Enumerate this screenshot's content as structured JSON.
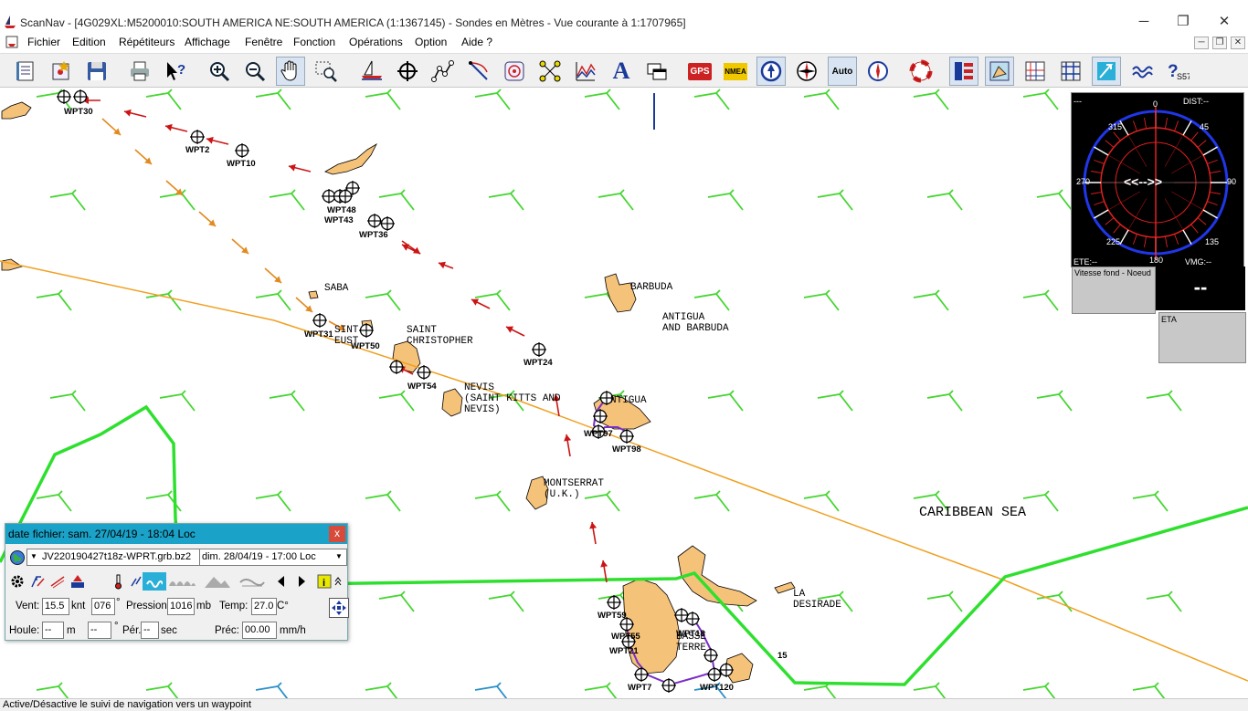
{
  "window": {
    "title": "ScanNav - [4G029XL:M5200010:SOUTH AMERICA NE:SOUTH AMERICA (1:1367145) - Sondes en  Mètres  - Vue courante à 1:1707965]"
  },
  "menu": {
    "items": [
      "Fichier",
      "Edition",
      "Répétiteurs",
      "Affichage",
      "Fenêtre",
      "Fonction",
      "Opérations",
      "Option",
      "Aide ?"
    ]
  },
  "toolbar": {
    "auto_label": "Auto",
    "gps_label": "GPS",
    "nmea_label": "NMEA",
    "text_label": "A"
  },
  "map": {
    "place_labels": [
      {
        "id": "saba",
        "text": "SABA"
      },
      {
        "id": "barbuda",
        "text": "BARBUDA"
      },
      {
        "id": "antigua-barbuda",
        "text": "ANTIGUA\nAND BARBUDA"
      },
      {
        "id": "saint-christopher",
        "text": "SAINT\nCHRISTOPHER"
      },
      {
        "id": "saint-eustatius",
        "text": "SINT\nEUST"
      },
      {
        "id": "nevis",
        "text": "NEVIS\n(SAINT KITTS AND\nNEVIS)"
      },
      {
        "id": "antigua",
        "text": "NTIGUA"
      },
      {
        "id": "montserrat",
        "text": "MONTSERRAT\n(U.K.)"
      },
      {
        "id": "caribbean-sea",
        "text": "CARIBBEAN SEA"
      },
      {
        "id": "la-desirade",
        "text": "LA\nDESIRADE"
      },
      {
        "id": "basse-terre",
        "text": "BASSE\nTERRE"
      },
      {
        "id": "depth-15",
        "text": "15"
      }
    ],
    "waypoints": [
      {
        "id": "wpt30",
        "label": "WPT30"
      },
      {
        "id": "wpt2",
        "label": "WPT2"
      },
      {
        "id": "wpt10",
        "label": "WPT10"
      },
      {
        "id": "wpt48",
        "label": "WPT48"
      },
      {
        "id": "wpt43",
        "label": "WPT43"
      },
      {
        "id": "wpt36",
        "label": "WPT36"
      },
      {
        "id": "wpt31",
        "label": "WPT31"
      },
      {
        "id": "wpt50",
        "label": "WPT50"
      },
      {
        "id": "wpt54",
        "label": "WPT54"
      },
      {
        "id": "wpt24",
        "label": "WPT24"
      },
      {
        "id": "wpt97",
        "label": "WPT97"
      },
      {
        "id": "wpt98",
        "label": "WPT98"
      },
      {
        "id": "wpt59",
        "label": "WPT59"
      },
      {
        "id": "wpt55",
        "label": "WPT55"
      },
      {
        "id": "wpt21",
        "label": "WPT21"
      },
      {
        "id": "wpt7",
        "label": "WPT7"
      },
      {
        "id": "wpt120",
        "label": "WPT120"
      },
      {
        "id": "wpt18",
        "label": "WPT18"
      }
    ]
  },
  "compass": {
    "top_label": "0",
    "dist_label": "DIST:--",
    "ete_label": "ETE:--",
    "vmg_label": "VMG:--",
    "bottom_label": "180",
    "center_text": "<<-->>",
    "top_left": "---",
    "bearings": [
      "315",
      "45",
      "270",
      "90",
      "225",
      "135"
    ]
  },
  "speed": {
    "label": "Vitesse fond - Noeud",
    "value": "--"
  },
  "eta": {
    "label": "ETA"
  },
  "grib": {
    "title": "date fichier: sam. 27/04/19 - 18:04 Loc",
    "close_label": "x",
    "file_name": "JV220190427t18z-WPRT.grb.bz2",
    "forecast_time": "dim. 28/04/19 - 17:00 Loc",
    "wind_label": "Vent:",
    "wind_speed": "15.5",
    "wind_unit": "knt",
    "wind_dir": "076",
    "deg_unit": "°",
    "pressure_label": "Pression:",
    "pressure_value": "1016",
    "pressure_unit": "mb",
    "temp_label": "Temp:",
    "temp_value": "27.0",
    "temp_unit": "C°",
    "swell_label": "Houle:",
    "swell_value": "--",
    "swell_unit": "m",
    "swell_dir": "--",
    "period_label": "Pér.",
    "period_value": "--",
    "period_unit": "sec",
    "precip_label": "Préc:",
    "precip_value": "00.00",
    "precip_unit": "mm/h"
  },
  "statusbar": {
    "text": "Active/Désactive le suivi de navigation vers un waypoint"
  },
  "colors": {
    "wind_barb": "#44d630",
    "route_line": "#f0a020",
    "land": "#f5c27a",
    "current_arrow_red": "#cc1414",
    "current_arrow_orange": "#e28a20",
    "contour": "#2ee02e",
    "route_purple": "#7a2ec8",
    "grib_title": "#1ba2c8"
  }
}
